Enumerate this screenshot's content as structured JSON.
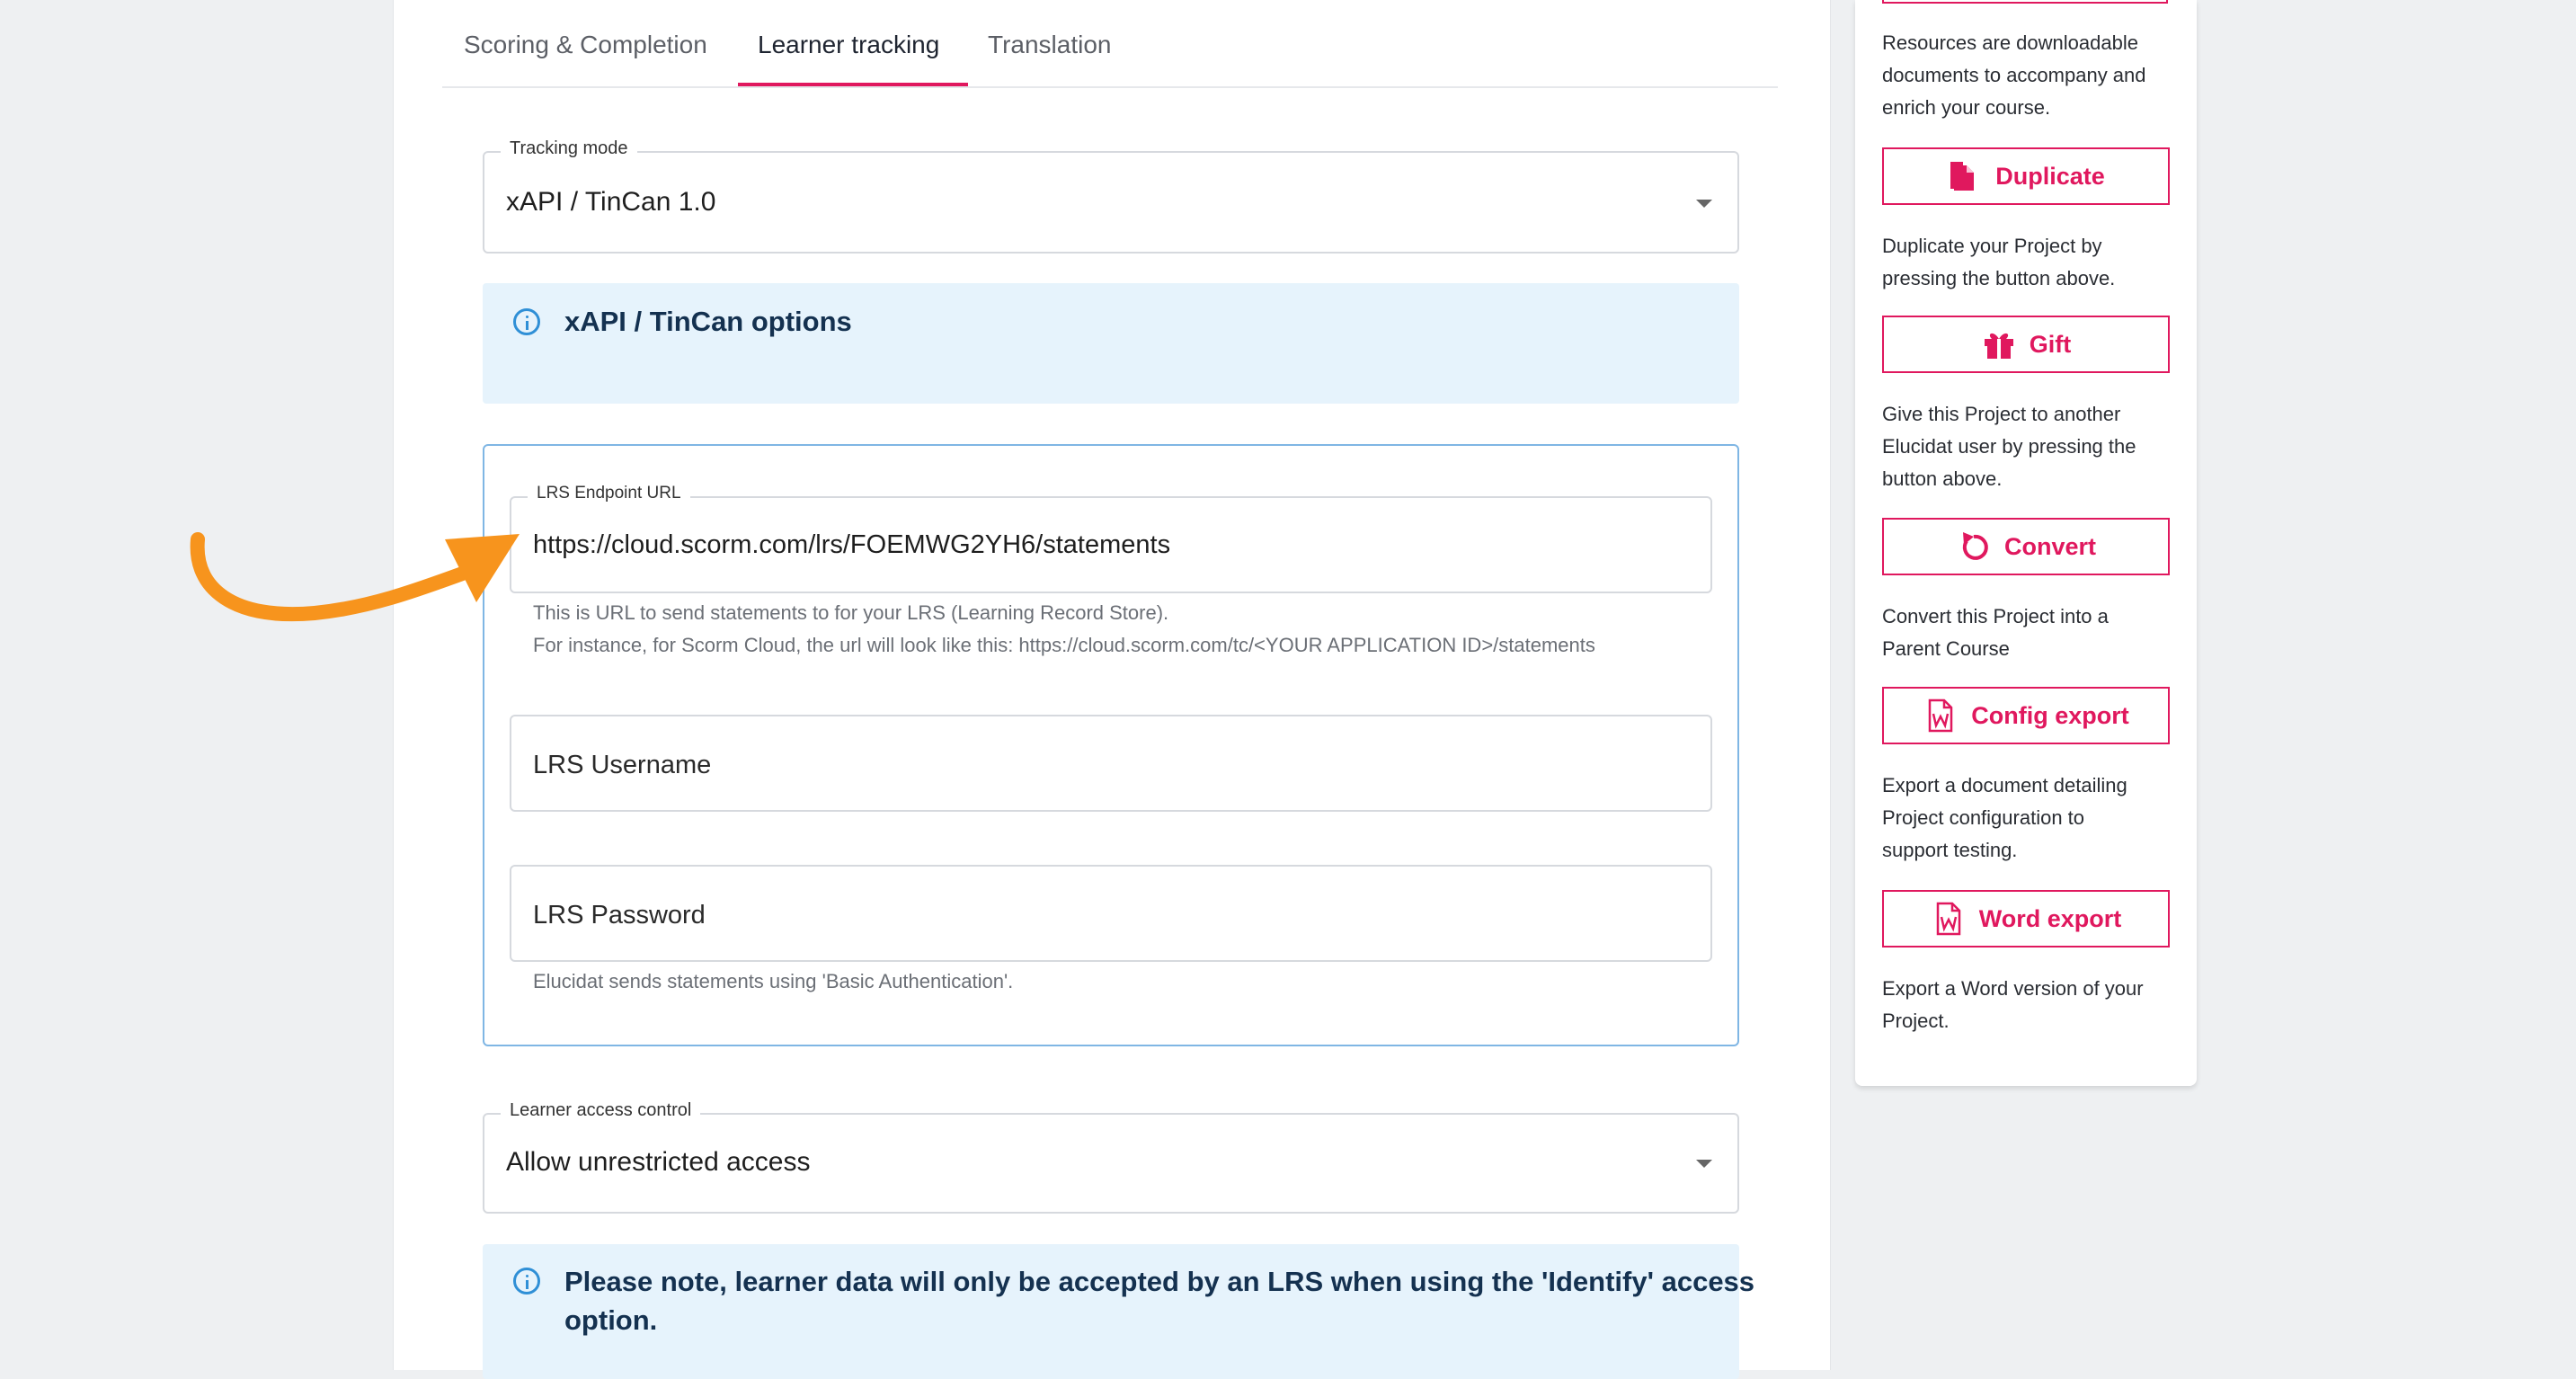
{
  "tabs": [
    {
      "label": "Scoring & Completion"
    },
    {
      "label": "Learner tracking",
      "active": true
    },
    {
      "label": "Translation"
    }
  ],
  "tracking_mode": {
    "legend": "Tracking mode",
    "value": "xAPI / TinCan 1.0"
  },
  "xapi_banner": {
    "title": "xAPI / TinCan options"
  },
  "lrs_endpoint": {
    "legend": "LRS Endpoint URL",
    "value": "https://cloud.scorm.com/lrs/FOEMWG2YH6/statements",
    "helper_line1": "This is URL to send statements to for your LRS (Learning Record Store).",
    "helper_line2": "For instance, for Scorm Cloud, the url will look like this: https://cloud.scorm.com/tc/<YOUR APPLICATION ID>/statements"
  },
  "lrs_username": {
    "placeholder": "LRS Username"
  },
  "lrs_password": {
    "placeholder": "LRS Password",
    "helper": "Elucidat sends statements using 'Basic Authentication'."
  },
  "learner_access": {
    "legend": "Learner access control",
    "value": "Allow unrestricted access"
  },
  "note_banner": {
    "line1": "Please note, learner data will only be accepted by an LRS when using the 'Identify' access",
    "line2": "option."
  },
  "sidebar": {
    "resources_text": [
      "Resources are downloadable",
      "documents to accompany and",
      "enrich your course."
    ],
    "duplicate": {
      "label": "Duplicate",
      "text": [
        "Duplicate your Project by",
        "pressing the button above."
      ]
    },
    "gift": {
      "label": "Gift",
      "text": [
        "Give this Project to another",
        "Elucidat user by pressing the",
        "button above."
      ]
    },
    "convert": {
      "label": "Convert",
      "text": [
        "Convert this Project into a",
        "Parent Course"
      ]
    },
    "config_export": {
      "label": "Config export",
      "text": [
        "Export a document detailing",
        "Project configuration to",
        "support testing."
      ]
    },
    "word_export": {
      "label": "Word export",
      "text": [
        "Export a Word version of your",
        "Project."
      ]
    }
  },
  "colors": {
    "accent": "#e0185e",
    "info_bg": "#e6f3fc",
    "info_icon": "#2f8fd6",
    "arrow": "#f7941d"
  }
}
